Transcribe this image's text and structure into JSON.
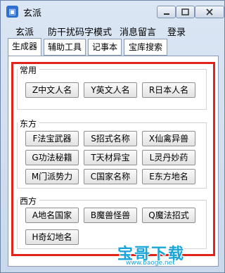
{
  "window": {
    "title": "玄派"
  },
  "menu": [
    "玄派",
    "防干扰码字模式",
    "消息留言",
    "登录"
  ],
  "tabs": [
    "生成器",
    "辅助工具",
    "记事本",
    "宝库搜索"
  ],
  "groups": {
    "common": {
      "label": "常用",
      "buttons": [
        "Z中文人名",
        "Y英文人名",
        "R日本人名"
      ]
    },
    "east": {
      "label": "东方",
      "buttons": [
        "F法宝武器",
        "S招式名称",
        "X仙禽异兽",
        "G功法秘籍",
        "T天材异宝",
        "L灵丹妙药",
        "M门派势力",
        "C国家名称",
        "E东方地名"
      ]
    },
    "west": {
      "label": "西方",
      "buttons": [
        "A地名国家",
        "B魔兽怪兽",
        "Q魔法招式",
        "H奇幻地名"
      ]
    }
  },
  "watermark": {
    "text": "宝哥下载",
    "url": "www.baoge.net"
  }
}
